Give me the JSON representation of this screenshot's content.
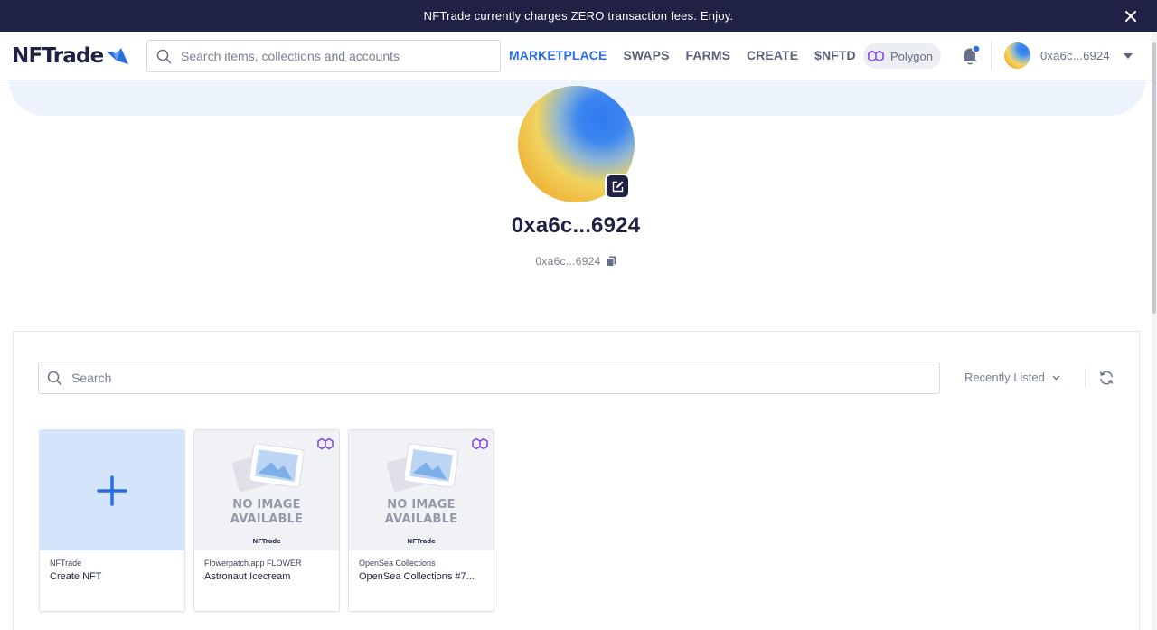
{
  "banner": {
    "message": "NFTrade currently charges ZERO transaction fees. Enjoy.",
    "close_icon": "close-icon"
  },
  "header": {
    "logo_text": "NFTrade",
    "search_placeholder": "Search items, collections and accounts",
    "nav": [
      {
        "label": "MARKETPLACE",
        "active": true
      },
      {
        "label": "SWAPS",
        "active": false
      },
      {
        "label": "FARMS",
        "active": false
      },
      {
        "label": "CREATE",
        "active": false
      },
      {
        "label": "$NFTD",
        "active": false
      }
    ],
    "network": "Polygon",
    "account_address": "0xa6c...6924",
    "icons": [
      "search-icon",
      "polygon-icon",
      "bell-icon",
      "chevron-down-icon"
    ]
  },
  "profile": {
    "name": "0xa6c...6924",
    "address": "0xa6c...6924",
    "icons": [
      "edit-icon",
      "copy-icon"
    ]
  },
  "filters": {
    "search_placeholder": "Search",
    "sort_label": "Recently Listed",
    "icons": [
      "search-icon",
      "chevron-down-icon",
      "refresh-icon"
    ]
  },
  "cards": [
    {
      "subtitle": "NFTrade",
      "title": "Create NFT",
      "type": "create"
    },
    {
      "subtitle": "Flowerpatch.app FLOWER",
      "title": "Astronaut Icecream",
      "type": "nft",
      "image_text_1": "NO IMAGE",
      "image_text_2": "AVAILABLE",
      "image_brand": "NFTrade"
    },
    {
      "subtitle": "OpenSea Collections",
      "title": "OpenSea Collections #7...",
      "type": "nft",
      "image_text_1": "NO IMAGE",
      "image_text_2": "AVAILABLE",
      "image_brand": "NFTrade"
    }
  ],
  "colors": {
    "banner_bg": "#1f2245",
    "accent": "#2a6fdb",
    "cover_bg": "#edf3fd",
    "create_card_bg": "#d3e4fb",
    "polygon_purple": "#8247e5"
  }
}
